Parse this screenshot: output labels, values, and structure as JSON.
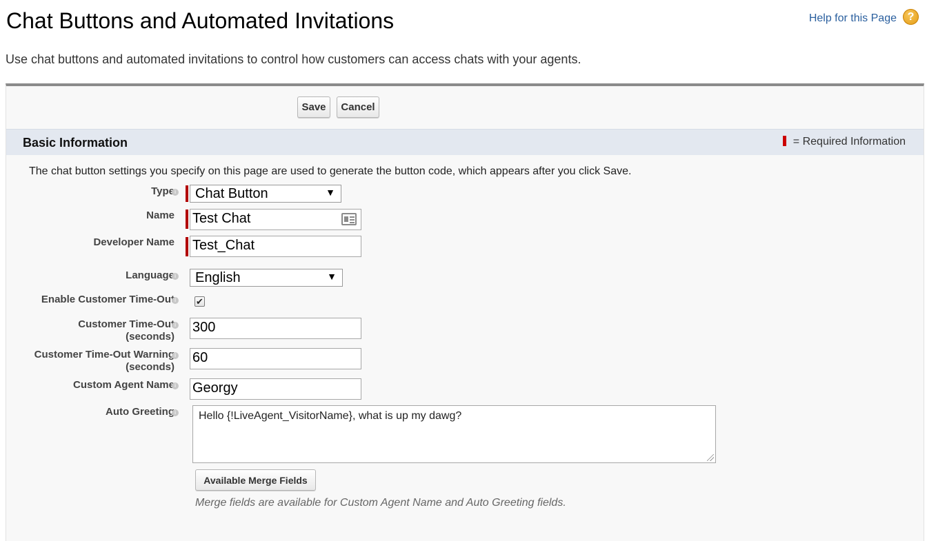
{
  "header": {
    "title": "Chat Buttons and Automated Invitations",
    "help_link": "Help for this Page",
    "help_icon": "help-icon",
    "description": "Use chat buttons and automated invitations to control how customers can access chats with your agents."
  },
  "toolbar": {
    "save_label": "Save",
    "cancel_label": "Cancel"
  },
  "section": {
    "title": "Basic Information",
    "required_legend": "= Required Information",
    "required_color": "#c00000",
    "intro": "The chat button settings you specify on this page are used to generate the button code, which appears after you click Save."
  },
  "fields": {
    "type": {
      "label": "Type",
      "value": "Chat Button"
    },
    "name": {
      "label": "Name",
      "value": "Test Chat",
      "icon": "contact-card-icon"
    },
    "developer_name": {
      "label": "Developer Name",
      "value": "Test_Chat"
    },
    "language": {
      "label": "Language",
      "value": "English"
    },
    "enable_timeout": {
      "label": "Enable Customer Time-Out",
      "checked": true
    },
    "timeout": {
      "label_line1": "Customer Time-Out",
      "label_line2": "(seconds)",
      "value": "300"
    },
    "timeout_warning": {
      "label_line1": "Customer Time-Out Warning",
      "label_line2": "(seconds)",
      "value": "60"
    },
    "custom_agent_name": {
      "label": "Custom Agent Name",
      "value": "Georgy"
    },
    "auto_greeting": {
      "label": "Auto Greeting",
      "value": "Hello {!LiveAgent_VisitorName}, what is up my dawg?"
    }
  },
  "merge": {
    "button_label": "Available Merge Fields",
    "hint": "Merge fields are available for Custom Agent Name and Auto Greeting fields."
  }
}
